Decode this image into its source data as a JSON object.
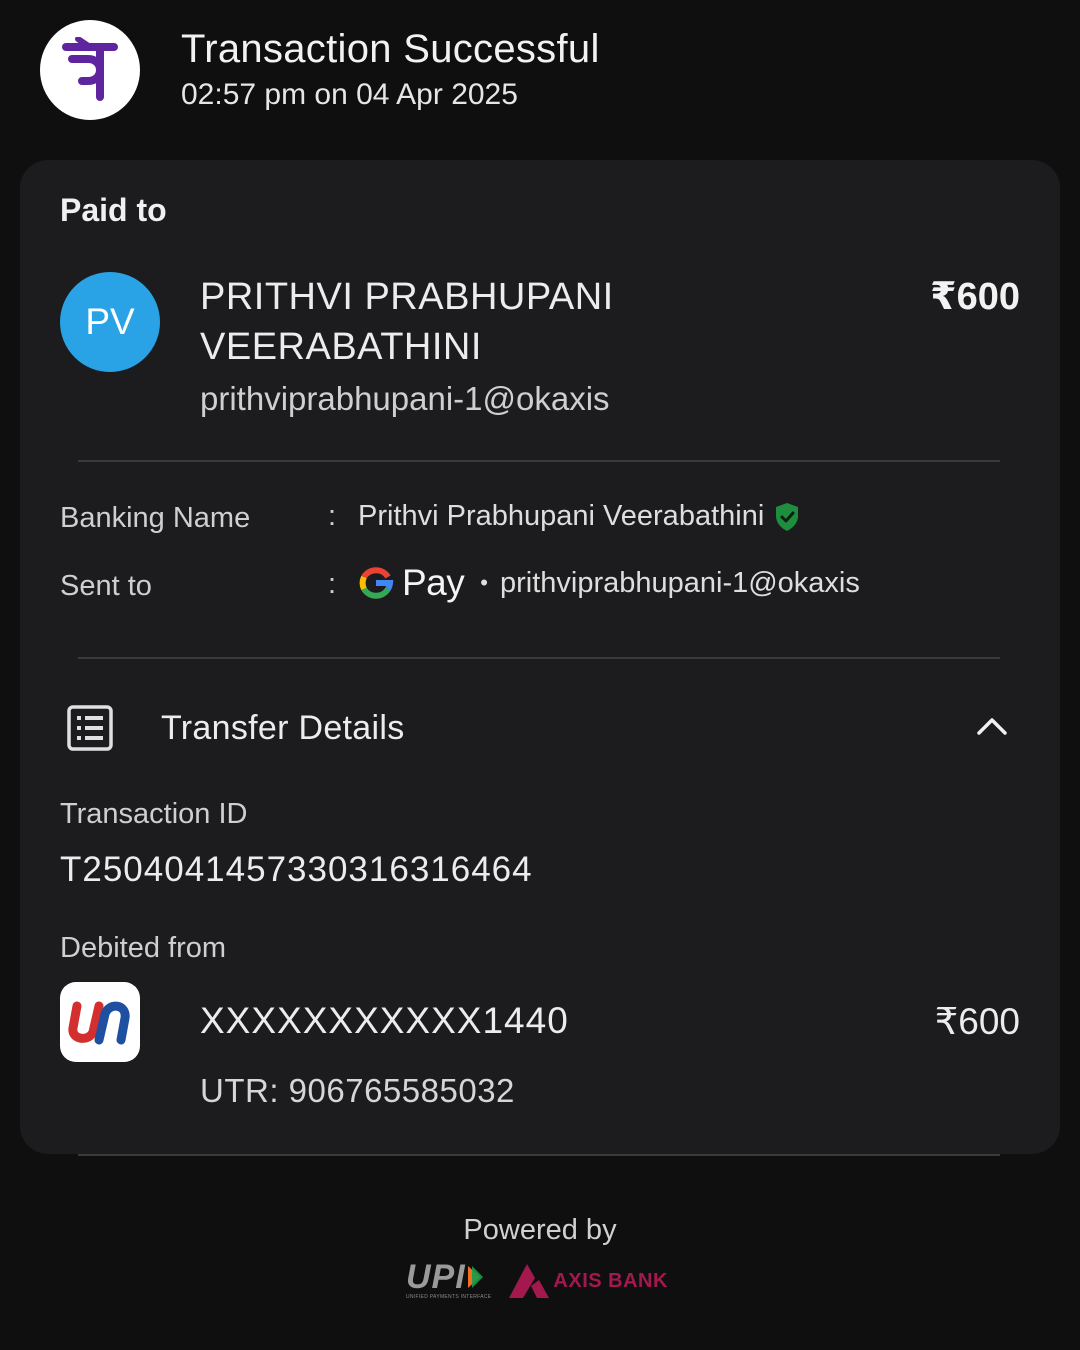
{
  "header": {
    "title": "Transaction Successful",
    "timestamp": "02:57 pm on 04 Apr 2025",
    "app_icon": "phonepe-logo"
  },
  "paid_to": {
    "label": "Paid to",
    "avatar_initials": "PV",
    "name": "PRITHVI PRABHUPANI VEERABATHINI",
    "vpa": "prithviprabhupani-1@okaxis",
    "amount": "₹600"
  },
  "details": {
    "banking_name_label": "Banking Name",
    "banking_name_value": "Prithvi Prabhupani Veerabathini",
    "sent_to_label": "Sent to",
    "sent_to_app": "Pay",
    "sent_to_vpa": "prithviprabhupani-1@okaxis",
    "colon": ":",
    "separator": "•"
  },
  "transfer": {
    "title": "Transfer Details",
    "transaction_id_label": "Transaction ID",
    "transaction_id": "T2504041457330316316464",
    "debited_from_label": "Debited from",
    "account_number": "XXXXXXXXXXX1440",
    "amount": "₹600",
    "utr": "UTR: 906765585032"
  },
  "footer": {
    "powered_by": "Powered by",
    "upi_text": "UPI",
    "upi_subtext": "UNIFIED PAYMENTS INTERFACE",
    "bank_text": "AXIS BANK"
  },
  "colors": {
    "background": "#0f0f10",
    "card": "#1c1c1e",
    "avatar": "#29a3e6",
    "phonepe_purple": "#5f259f",
    "verified_green": "#1e8e3e",
    "axis_maroon": "#a3194d"
  }
}
